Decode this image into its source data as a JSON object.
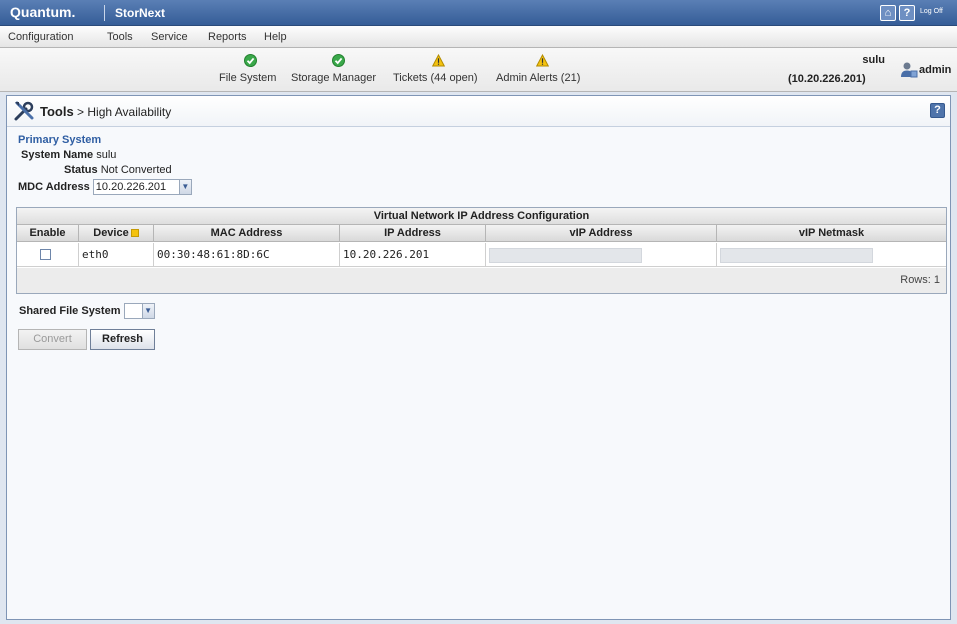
{
  "app": {
    "brand": "Quantum.",
    "product": "StorNext",
    "home_icon": "home-icon",
    "help_icon": "help-icon",
    "logoff_label": "Log Off"
  },
  "menu": {
    "items": [
      "Configuration",
      "Tools",
      "Service",
      "Reports",
      "Help"
    ]
  },
  "status": {
    "items": [
      {
        "label": "File System",
        "icon": "check-ok-icon"
      },
      {
        "label": "Storage Manager",
        "icon": "check-ok-icon"
      },
      {
        "label": "Tickets (44 open)",
        "icon": "warning-icon"
      },
      {
        "label": "Admin Alerts (21)",
        "icon": "warning-icon"
      }
    ],
    "host": "sulu",
    "host_ip": "(10.20.226.201)",
    "user": "admin"
  },
  "page": {
    "section": "Tools",
    "breadcrumb_rest": " > High Availability",
    "help_label": "?"
  },
  "primary": {
    "title": "Primary System",
    "system_name_label": "System Name",
    "system_name": "sulu",
    "status_label": "Status",
    "status": "Not Converted",
    "mdc_label": "MDC Address",
    "mdc_value": "10.20.226.201"
  },
  "grid": {
    "title": "Virtual Network IP Address Configuration",
    "columns": [
      "Enable",
      "Device",
      "MAC Address",
      "IP Address",
      "vIP Address",
      "vIP Netmask"
    ],
    "rows": [
      {
        "device": "eth0",
        "mac": "00:30:48:61:8D:6C",
        "ip": "10.20.226.201",
        "vip": "",
        "netmask": ""
      }
    ],
    "rows_label": "Rows: 1"
  },
  "shared": {
    "label": "Shared File System",
    "value": ""
  },
  "buttons": {
    "convert": "Convert",
    "refresh": "Refresh"
  },
  "colors": {
    "titlebar": "#355d97",
    "accent": "#2f5ea3",
    "ok": "#3aa84a",
    "warning": "#f4c20f"
  }
}
